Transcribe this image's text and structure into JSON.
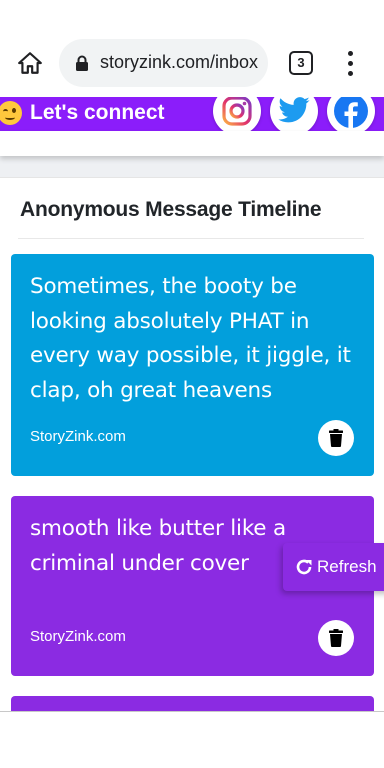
{
  "browser": {
    "url": "storyzink.com/inbox",
    "tab_count": "3"
  },
  "header": {
    "title": "Let's connect",
    "accent": "#8b1dfa"
  },
  "timeline": {
    "title": "Anonymous Message Timeline",
    "messages": [
      {
        "text": "Sometimes, the booty be looking absolutely PHAT in every way possible, it jiggle, it clap, oh great heavens",
        "footer": "StoryZink.com",
        "color": "#029fdc"
      },
      {
        "text": "smooth like butter like a criminal under cover",
        "footer": "StoryZink.com",
        "color": "#8b2be2"
      },
      {
        "text": "",
        "footer": "",
        "color": "#8b2be2"
      }
    ]
  },
  "refresh": {
    "label": "Refresh"
  },
  "icons": {
    "home": "home-icon",
    "lock": "lock-icon",
    "menu": "more-vert-icon",
    "instagram": "instagram-icon",
    "twitter": "twitter-icon",
    "facebook": "facebook-icon",
    "trash": "trash-icon",
    "refresh": "refresh-icon"
  }
}
